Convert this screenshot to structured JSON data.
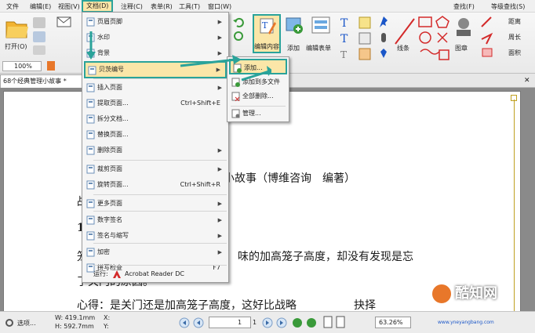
{
  "menubar": {
    "items": [
      "文件",
      "编辑(E)",
      "视图(V)",
      "文档(D)",
      "注释(C)",
      "表单(R)",
      "工具(T)",
      "窗口(W)"
    ],
    "right_items": [
      "查找(F)",
      "等级查找(S)"
    ]
  },
  "ribbon": {
    "open_label": "打开(O)",
    "zoom_value": "100%",
    "edit_content_label": "编辑内容",
    "add_label": "添加",
    "edit_form_label": "编辑表单",
    "line_label": "线条",
    "shape_label": "图章",
    "distance_label": "距离",
    "perimeter_label": "周长",
    "area_label": "面积"
  },
  "doc_tab": {
    "label": "68个经典管理小故事 *"
  },
  "menu": {
    "items": [
      {
        "label": "页眉页脚",
        "shortcut": "",
        "submenu": true,
        "icon": "header-footer-icon"
      },
      {
        "label": "水印",
        "shortcut": "",
        "submenu": true,
        "icon": "watermark-icon"
      },
      {
        "label": "背景",
        "shortcut": "",
        "submenu": true,
        "icon": "background-icon"
      },
      {
        "label": "贝茨编号",
        "shortcut": "",
        "submenu": true,
        "icon": "bates-numbering-icon",
        "highlighted": true
      },
      {
        "label": "插入页面",
        "shortcut": "",
        "submenu": true,
        "icon": "insert-page-icon"
      },
      {
        "label": "提取页面...",
        "shortcut": "Ctrl+Shift+E",
        "submenu": false,
        "icon": "extract-page-icon"
      },
      {
        "label": "拆分文档...",
        "shortcut": "",
        "submenu": false,
        "icon": "split-document-icon"
      },
      {
        "label": "替换页面...",
        "shortcut": "",
        "submenu": false,
        "icon": "replace-page-icon"
      },
      {
        "label": "删除页面",
        "shortcut": "",
        "submenu": true,
        "icon": "delete-page-icon"
      },
      {
        "label": "裁剪页面",
        "shortcut": "",
        "submenu": true,
        "icon": "crop-page-icon"
      },
      {
        "label": "旋转页面...",
        "shortcut": "Ctrl+Shift+R",
        "submenu": false,
        "icon": "rotate-page-icon"
      },
      {
        "label": "更多页面",
        "shortcut": "",
        "submenu": true,
        "icon": "more-pages-icon"
      },
      {
        "label": "数字签名",
        "shortcut": "",
        "submenu": true,
        "icon": "digital-signature-icon"
      },
      {
        "label": "签名与缩写",
        "shortcut": "",
        "submenu": true,
        "icon": "sign-initials-icon"
      },
      {
        "label": "加密",
        "shortcut": "",
        "submenu": true,
        "icon": "encrypt-icon"
      },
      {
        "label": "拼写检查",
        "shortcut": "F7",
        "submenu": false,
        "icon": "spell-check-icon"
      }
    ],
    "run_label": "运行:",
    "run_app": "Acrobat Reader DC"
  },
  "submenu": {
    "items": [
      "添加...",
      "添加到多文件",
      "全部删除...",
      "管理..."
    ]
  },
  "document": {
    "title_line": "小故事（博维咨询　编著）",
    "line_dash": "战",
    "line_1": "1",
    "line_a": "笼",
    "line_b": "味的加高笼子高度，却没有发现是忘",
    "line_c": "了关门的原因。",
    "line_d": "心得：是关门还是加高笼子高度，这好比战略",
    "line_e": "抉择"
  },
  "status": {
    "options_label": "选项...",
    "width": "W: 419.1mm",
    "height": "H: 592.7mm",
    "x_label": "X:",
    "y_label": "Y:",
    "page_value": "1",
    "page_total": "1",
    "zoom_value": "63.26%"
  },
  "watermark": {
    "brand": "酷知网",
    "url": "www.yneyangbang.com"
  },
  "colors": {
    "teal": "#2aa39a",
    "highlight": "#fbe6a8",
    "menu_bg": "#f5f5f5"
  }
}
